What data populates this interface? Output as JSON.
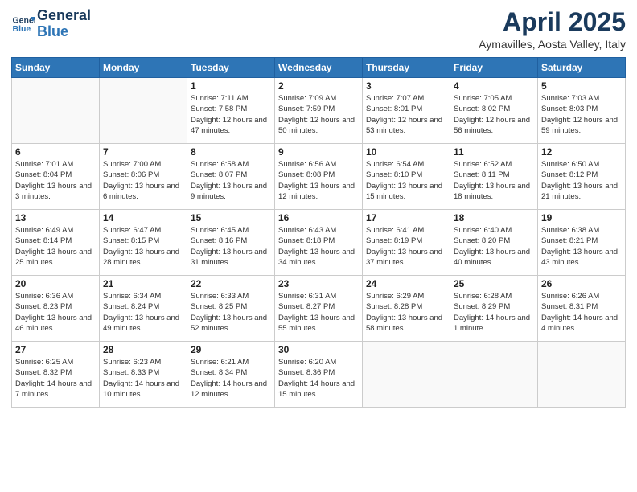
{
  "logo": {
    "line1": "General",
    "line2": "Blue"
  },
  "title": "April 2025",
  "location": "Aymavilles, Aosta Valley, Italy",
  "weekdays": [
    "Sunday",
    "Monday",
    "Tuesday",
    "Wednesday",
    "Thursday",
    "Friday",
    "Saturday"
  ],
  "weeks": [
    [
      {
        "day": "",
        "info": ""
      },
      {
        "day": "",
        "info": ""
      },
      {
        "day": "1",
        "info": "Sunrise: 7:11 AM\nSunset: 7:58 PM\nDaylight: 12 hours and 47 minutes."
      },
      {
        "day": "2",
        "info": "Sunrise: 7:09 AM\nSunset: 7:59 PM\nDaylight: 12 hours and 50 minutes."
      },
      {
        "day": "3",
        "info": "Sunrise: 7:07 AM\nSunset: 8:01 PM\nDaylight: 12 hours and 53 minutes."
      },
      {
        "day": "4",
        "info": "Sunrise: 7:05 AM\nSunset: 8:02 PM\nDaylight: 12 hours and 56 minutes."
      },
      {
        "day": "5",
        "info": "Sunrise: 7:03 AM\nSunset: 8:03 PM\nDaylight: 12 hours and 59 minutes."
      }
    ],
    [
      {
        "day": "6",
        "info": "Sunrise: 7:01 AM\nSunset: 8:04 PM\nDaylight: 13 hours and 3 minutes."
      },
      {
        "day": "7",
        "info": "Sunrise: 7:00 AM\nSunset: 8:06 PM\nDaylight: 13 hours and 6 minutes."
      },
      {
        "day": "8",
        "info": "Sunrise: 6:58 AM\nSunset: 8:07 PM\nDaylight: 13 hours and 9 minutes."
      },
      {
        "day": "9",
        "info": "Sunrise: 6:56 AM\nSunset: 8:08 PM\nDaylight: 13 hours and 12 minutes."
      },
      {
        "day": "10",
        "info": "Sunrise: 6:54 AM\nSunset: 8:10 PM\nDaylight: 13 hours and 15 minutes."
      },
      {
        "day": "11",
        "info": "Sunrise: 6:52 AM\nSunset: 8:11 PM\nDaylight: 13 hours and 18 minutes."
      },
      {
        "day": "12",
        "info": "Sunrise: 6:50 AM\nSunset: 8:12 PM\nDaylight: 13 hours and 21 minutes."
      }
    ],
    [
      {
        "day": "13",
        "info": "Sunrise: 6:49 AM\nSunset: 8:14 PM\nDaylight: 13 hours and 25 minutes."
      },
      {
        "day": "14",
        "info": "Sunrise: 6:47 AM\nSunset: 8:15 PM\nDaylight: 13 hours and 28 minutes."
      },
      {
        "day": "15",
        "info": "Sunrise: 6:45 AM\nSunset: 8:16 PM\nDaylight: 13 hours and 31 minutes."
      },
      {
        "day": "16",
        "info": "Sunrise: 6:43 AM\nSunset: 8:18 PM\nDaylight: 13 hours and 34 minutes."
      },
      {
        "day": "17",
        "info": "Sunrise: 6:41 AM\nSunset: 8:19 PM\nDaylight: 13 hours and 37 minutes."
      },
      {
        "day": "18",
        "info": "Sunrise: 6:40 AM\nSunset: 8:20 PM\nDaylight: 13 hours and 40 minutes."
      },
      {
        "day": "19",
        "info": "Sunrise: 6:38 AM\nSunset: 8:21 PM\nDaylight: 13 hours and 43 minutes."
      }
    ],
    [
      {
        "day": "20",
        "info": "Sunrise: 6:36 AM\nSunset: 8:23 PM\nDaylight: 13 hours and 46 minutes."
      },
      {
        "day": "21",
        "info": "Sunrise: 6:34 AM\nSunset: 8:24 PM\nDaylight: 13 hours and 49 minutes."
      },
      {
        "day": "22",
        "info": "Sunrise: 6:33 AM\nSunset: 8:25 PM\nDaylight: 13 hours and 52 minutes."
      },
      {
        "day": "23",
        "info": "Sunrise: 6:31 AM\nSunset: 8:27 PM\nDaylight: 13 hours and 55 minutes."
      },
      {
        "day": "24",
        "info": "Sunrise: 6:29 AM\nSunset: 8:28 PM\nDaylight: 13 hours and 58 minutes."
      },
      {
        "day": "25",
        "info": "Sunrise: 6:28 AM\nSunset: 8:29 PM\nDaylight: 14 hours and 1 minute."
      },
      {
        "day": "26",
        "info": "Sunrise: 6:26 AM\nSunset: 8:31 PM\nDaylight: 14 hours and 4 minutes."
      }
    ],
    [
      {
        "day": "27",
        "info": "Sunrise: 6:25 AM\nSunset: 8:32 PM\nDaylight: 14 hours and 7 minutes."
      },
      {
        "day": "28",
        "info": "Sunrise: 6:23 AM\nSunset: 8:33 PM\nDaylight: 14 hours and 10 minutes."
      },
      {
        "day": "29",
        "info": "Sunrise: 6:21 AM\nSunset: 8:34 PM\nDaylight: 14 hours and 12 minutes."
      },
      {
        "day": "30",
        "info": "Sunrise: 6:20 AM\nSunset: 8:36 PM\nDaylight: 14 hours and 15 minutes."
      },
      {
        "day": "",
        "info": ""
      },
      {
        "day": "",
        "info": ""
      },
      {
        "day": "",
        "info": ""
      }
    ]
  ]
}
